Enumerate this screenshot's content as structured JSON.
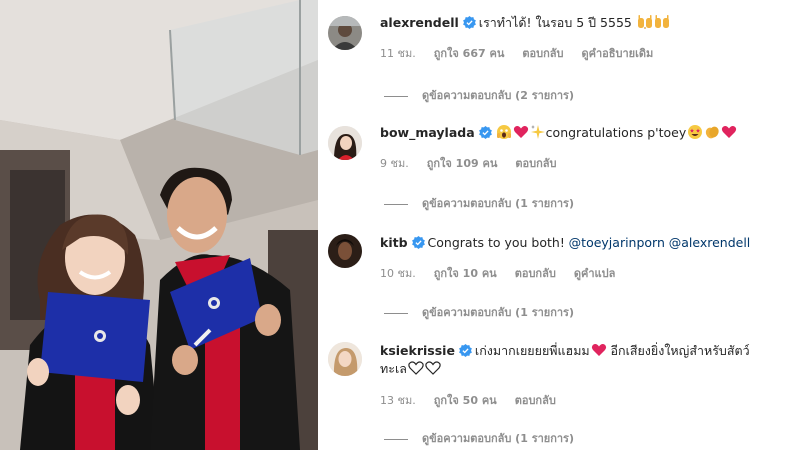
{
  "comments": [
    {
      "username": "alexrendell",
      "text": "เราทำได้! ในรอบ 5 ปี 5555",
      "emojis": [
        "raising-hands-emoji",
        "raising-hands-emoji"
      ],
      "time": "11 ชม.",
      "likes": "ถูกใจ 667 คน",
      "reply": "ตอบกลับ",
      "extra_action": "ดูคำอธิบายเดิม",
      "view_replies": "ดูข้อความตอบกลับ (2 รายการ)"
    },
    {
      "username": "bow_maylada",
      "text_after_emojis": "congratulations p'toey",
      "emojis_before": [
        "screaming-face-emoji",
        "red-heart-emoji",
        "sparkles-emoji"
      ],
      "emojis_after": [
        "star-struck-emoji",
        "clapping-hands-emoji",
        "red-heart-emoji"
      ],
      "time": "9 ชม.",
      "likes": "ถูกใจ 109 คน",
      "reply": "ตอบกลับ",
      "view_replies": "ดูข้อความตอบกลับ (1 รายการ)"
    },
    {
      "username": "kitb",
      "text": "Congrats to you both!",
      "mention_1": "@toeyjarinporn",
      "mention_2": "@alexrendell",
      "time": "10 ชม.",
      "likes": "ถูกใจ 10 คน",
      "reply": "ตอบกลับ",
      "extra_action": "ดูคำแปล",
      "view_replies": "ดูข้อความตอบกลับ (1 รายการ)"
    },
    {
      "username": "ksiekrissie",
      "text_line1": "เก่งมากเยยยยพี่แฮมม",
      "text_line1_after": "อีกเสียงยิ่งใหญ่สำหรับสัตว์",
      "text_line2": "ทะเล",
      "emojis_mid": [
        "red-heart-emoji"
      ],
      "emojis_end": [
        "white-heart-emoji",
        "white-heart-emoji"
      ],
      "time": "13 ชม.",
      "likes": "ถูกใจ 50 คน",
      "reply": "ตอบกลับ",
      "view_replies": "ดูข้อความตอบกลับ (1 รายการ)"
    }
  ],
  "colors": {
    "verified": "#3897f0",
    "meta_text": "#8e8e8e",
    "mention": "#00376b",
    "heart": "#e0245e",
    "gown_red": "#c8102e",
    "diploma_blue": "#1d2fa8"
  }
}
